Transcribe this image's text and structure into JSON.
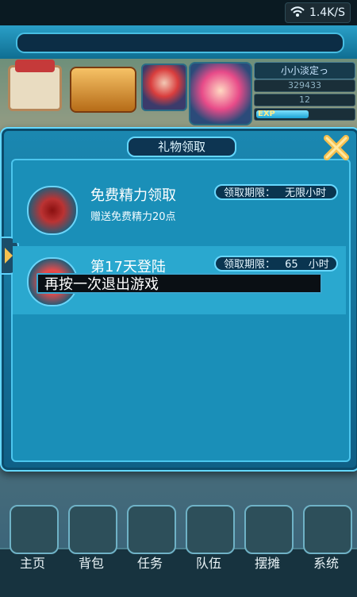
{
  "status_bar": {
    "network_speed": "1.4K/S",
    "icons": [
      "wifi-icon"
    ]
  },
  "player": {
    "name": "小小淡定っ",
    "gold": "329433",
    "level": "12",
    "exp_label": "EXP",
    "exp_progress": 0.55
  },
  "modal": {
    "title": "礼物领取",
    "items": [
      {
        "title": "免费精力领取",
        "subtitle": "赠送免费精力20点",
        "limit_label": "领取期限：",
        "limit_value": "无限小时",
        "icon": "energy-gift-icon"
      },
      {
        "title": "第17天登陆",
        "limit_label": "领取期限：",
        "limit_value": "65　小时",
        "icon": "login-gift-icon"
      }
    ]
  },
  "toast": {
    "text": "再按一次退出游戏"
  },
  "bottom_menu": [
    {
      "label": "主页",
      "icon": "home-icon"
    },
    {
      "label": "背包",
      "icon": "backpack-icon"
    },
    {
      "label": "任务",
      "icon": "quest-scroll-icon"
    },
    {
      "label": "队伍",
      "icon": "team-icon"
    },
    {
      "label": "摆摊",
      "icon": "stall-icon"
    },
    {
      "label": "系统",
      "icon": "system-gear-icon"
    }
  ],
  "colors": {
    "accent": "#65d9ff",
    "panel": "#1a8fb8",
    "panel_dark": "#0f5f86",
    "highlight_row": "#2aa8cf",
    "close_icon": "#f6c04f",
    "toast_bg": "#0a0f14"
  }
}
